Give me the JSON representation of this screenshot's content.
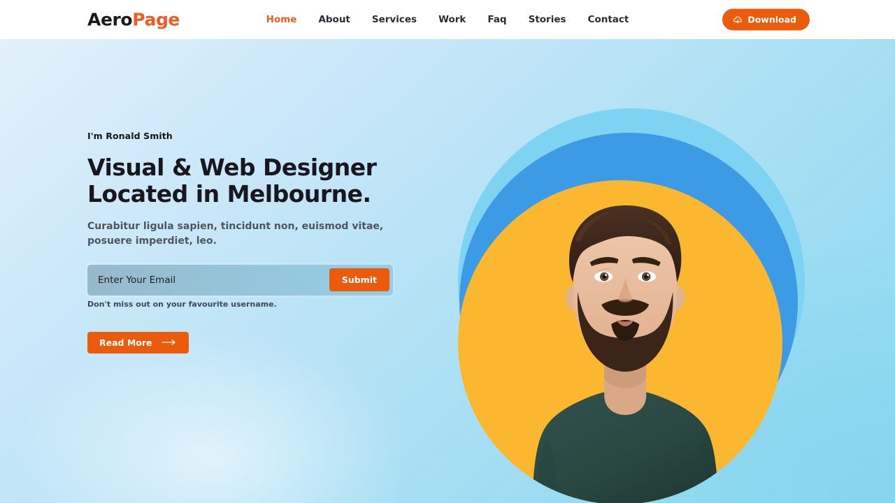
{
  "header": {
    "logo": {
      "part1": "Aero",
      "part2": "Page"
    },
    "nav": [
      {
        "label": "Home",
        "active": true
      },
      {
        "label": "About",
        "active": false
      },
      {
        "label": "Services",
        "active": false
      },
      {
        "label": "Work",
        "active": false
      },
      {
        "label": "Faq",
        "active": false
      },
      {
        "label": "Stories",
        "active": false
      },
      {
        "label": "Contact",
        "active": false
      }
    ],
    "download_button": {
      "label": "Download",
      "icon": "cloud-download-icon"
    }
  },
  "hero": {
    "eyebrow": "I'm Ronald Smith",
    "headline": "Visual & Web Designer Located in Melbourne.",
    "subtitle": "Curabitur ligula sapien, tincidunt non, euismod vitae, posuere imperdiet, leo.",
    "form": {
      "email_placeholder": "Enter Your Email",
      "email_value": "",
      "submit_label": "Submit",
      "helper_text": "Don't miss out on your favourite username."
    },
    "read_more_button": {
      "label": "Read More",
      "icon": "arrow-right-icon"
    },
    "portrait_alt": "Portrait of Ronald Smith"
  },
  "colors": {
    "accent_orange": "#ea5b0c",
    "logo_orange": "#f15a22",
    "ring_outer_blue": "#7ed2f2",
    "ring_mid_blue": "#3d9ae5",
    "ring_inner_yellow": "#fcb731",
    "shirt_green": "#2b4a46",
    "text_dark": "#17171d",
    "text_muted": "#4d5560",
    "header_bg": "#ffffff"
  }
}
